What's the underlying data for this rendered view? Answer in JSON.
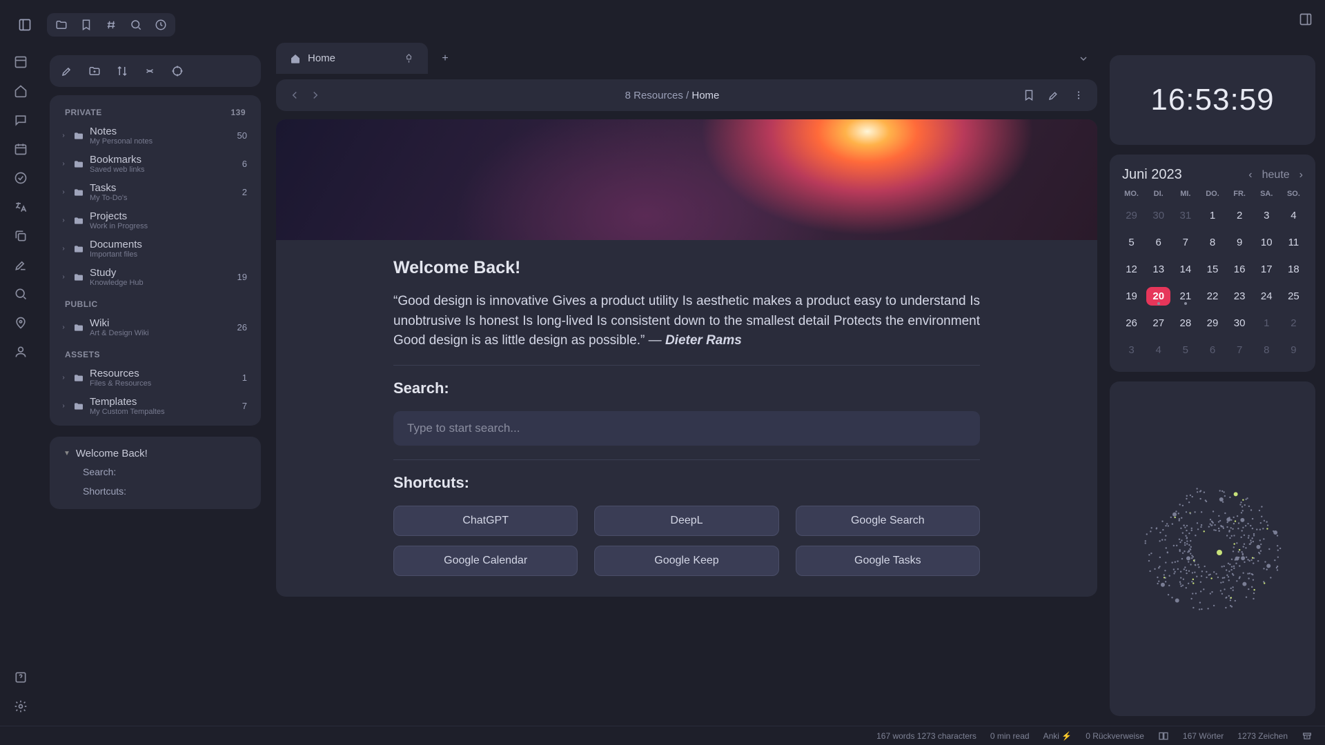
{
  "tab": {
    "label": "Home"
  },
  "breadcrumb": {
    "parent": "8 Resources",
    "sep": "/",
    "current": "Home"
  },
  "sidebar": {
    "sections": {
      "private": {
        "label": "PRIVATE",
        "count": "139"
      },
      "public": {
        "label": "PUBLIC"
      },
      "assets": {
        "label": "ASSETS"
      }
    },
    "items": [
      {
        "name": "Notes",
        "sub": "My Personal notes",
        "count": "50"
      },
      {
        "name": "Bookmarks",
        "sub": "Saved web links",
        "count": "6"
      },
      {
        "name": "Tasks",
        "sub": "My To-Do's",
        "count": "2"
      },
      {
        "name": "Projects",
        "sub": "Work in Progress",
        "count": ""
      },
      {
        "name": "Documents",
        "sub": "Important files",
        "count": ""
      },
      {
        "name": "Study",
        "sub": "Knowledge Hub",
        "count": "19"
      },
      {
        "name": "Wiki",
        "sub": "Art & Design Wiki",
        "count": "26"
      },
      {
        "name": "Resources",
        "sub": "Files & Resources",
        "count": "1"
      },
      {
        "name": "Templates",
        "sub": "My Custom Tempaltes",
        "count": "7"
      }
    ]
  },
  "outline": {
    "head": "Welcome Back!",
    "items": [
      "Search:",
      "Shortcuts:"
    ]
  },
  "page": {
    "h1": "Welcome Back!",
    "quote_text": "“Good design is innovative Gives a product utility Is aesthetic makes a product easy to understand Is unobtrusive Is honest Is long-lived Is consistent down to the smallest detail Protects the environment Good design is as little design as possible.” — ",
    "quote_author": "Dieter Rams",
    "search_label": "Search:",
    "search_placeholder": "Type to start search...",
    "shortcuts_label": "Shortcuts:",
    "shortcuts": [
      "ChatGPT",
      "DeepL",
      "Google Search",
      "Google Calendar",
      "Google Keep",
      "Google Tasks"
    ]
  },
  "clock": "16:53:59",
  "calendar": {
    "title": "Juni 2023",
    "today_label": "heute",
    "dow": [
      "MO.",
      "DI.",
      "MI.",
      "DO.",
      "FR.",
      "SA.",
      "SO."
    ],
    "days": [
      {
        "n": "29",
        "o": true
      },
      {
        "n": "30",
        "o": true
      },
      {
        "n": "31",
        "o": true
      },
      {
        "n": "1"
      },
      {
        "n": "2"
      },
      {
        "n": "3"
      },
      {
        "n": "4"
      },
      {
        "n": "5"
      },
      {
        "n": "6"
      },
      {
        "n": "7"
      },
      {
        "n": "8"
      },
      {
        "n": "9"
      },
      {
        "n": "10"
      },
      {
        "n": "11"
      },
      {
        "n": "12"
      },
      {
        "n": "13"
      },
      {
        "n": "14"
      },
      {
        "n": "15"
      },
      {
        "n": "16"
      },
      {
        "n": "17"
      },
      {
        "n": "18"
      },
      {
        "n": "19"
      },
      {
        "n": "20",
        "today": true,
        "dot": true
      },
      {
        "n": "21",
        "dot": true
      },
      {
        "n": "22"
      },
      {
        "n": "23"
      },
      {
        "n": "24"
      },
      {
        "n": "25"
      },
      {
        "n": "26"
      },
      {
        "n": "27"
      },
      {
        "n": "28"
      },
      {
        "n": "29"
      },
      {
        "n": "30"
      },
      {
        "n": "1",
        "o": true
      },
      {
        "n": "2",
        "o": true
      },
      {
        "n": "3",
        "o": true
      },
      {
        "n": "4",
        "o": true
      },
      {
        "n": "5",
        "o": true
      },
      {
        "n": "6",
        "o": true
      },
      {
        "n": "7",
        "o": true
      },
      {
        "n": "8",
        "o": true
      },
      {
        "n": "9",
        "o": true
      }
    ]
  },
  "status": {
    "words": "167 words 1273 characters",
    "readtime": "0 min read",
    "anki": "Anki",
    "backlinks": "0 Rückverweise",
    "de_words": "167 Wörter",
    "de_chars": "1273 Zeichen"
  }
}
